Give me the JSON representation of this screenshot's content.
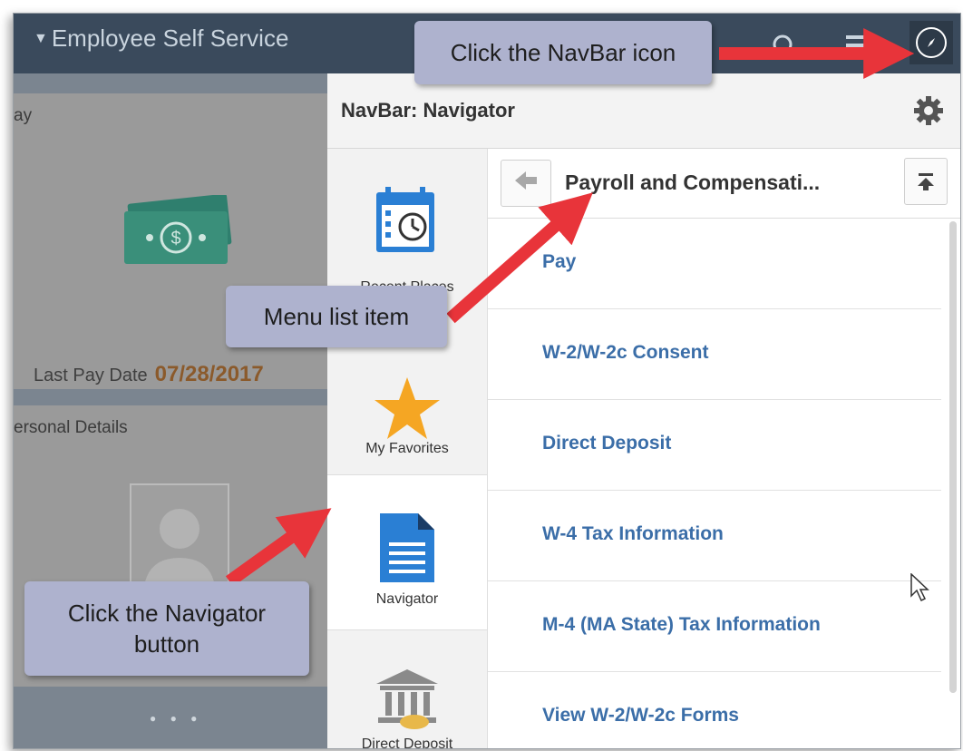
{
  "app": {
    "title": "Employee Self Service",
    "title_caret": "▼"
  },
  "background": {
    "pay_tile_title": "ay",
    "last_pay_label": "Last Pay Date",
    "last_pay_date": "07/28/2017",
    "personal_tile_title": "ersonal Details",
    "page_dots": "● ● ●"
  },
  "navbar": {
    "header": "NavBar: Navigator",
    "side_items": [
      {
        "label": "Recent Places"
      },
      {
        "label": "My Favorites"
      },
      {
        "label": "Navigator"
      },
      {
        "label": "Direct Deposit"
      }
    ],
    "breadcrumb_title": "Payroll and Compensati...",
    "menu_items": [
      {
        "label": "Pay"
      },
      {
        "label": "W-2/W-2c Consent"
      },
      {
        "label": "Direct Deposit"
      },
      {
        "label": "W-4 Tax Information"
      },
      {
        "label": "M-4 (MA State) Tax Information"
      },
      {
        "label": "View W-2/W-2c Forms"
      }
    ]
  },
  "callouts": {
    "navbar_icon": "Click the NavBar icon",
    "menu_list_item": "Menu list item",
    "navigator_button_line1": "Click the Navigator",
    "navigator_button_line2": "button"
  },
  "icons": [
    "caret-down-icon",
    "search-icon",
    "menu-icon",
    "compass-icon",
    "gear-icon",
    "back-arrow-icon",
    "scroll-top-icon",
    "calendar-clock-icon",
    "star-icon",
    "document-icon",
    "bank-icon",
    "money-icon",
    "person-icon",
    "mouse-cursor-icon"
  ],
  "colors": {
    "header_bg": "#3a4a5c",
    "link": "#3b6ea8",
    "callout": "#aeb2ce",
    "arrow": "#e8343a",
    "accent_blue": "#2a7fd4",
    "star": "#f5a623"
  }
}
